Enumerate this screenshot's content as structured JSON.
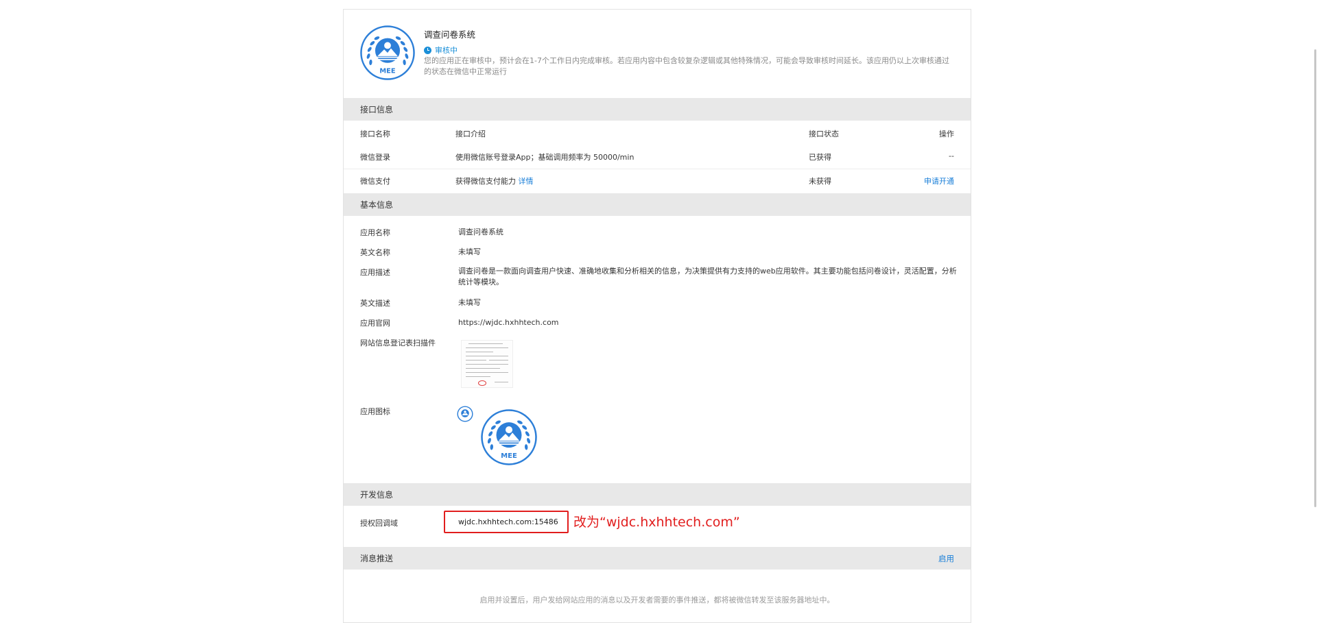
{
  "app": {
    "name": "调查问卷系统",
    "status": "审核中",
    "notice": "您的应用正在审核中，预计会在1-7个工作日内完成审核。若应用内容中包含较复杂逻辑或其他特殊情况，可能会导致审核时间延长。该应用仍以上次审核通过的状态在微信中正常运行",
    "logo_text": "MEE"
  },
  "interface": {
    "section_title": "接口信息",
    "columns": [
      "接口名称",
      "接口介绍",
      "接口状态",
      "操作"
    ],
    "rows": [
      {
        "name": "微信登录",
        "desc": "使用微信账号登录App；基础调用频率为 50000/min",
        "desc_link": "",
        "state": "已获得",
        "action": "--"
      },
      {
        "name": "微信支付",
        "desc": "获得微信支付能力",
        "desc_link": "详情",
        "state": "未获得",
        "action": "申请开通"
      }
    ]
  },
  "basic": {
    "section_title": "基本信息",
    "fields": {
      "app_name_label": "应用名称",
      "app_name": "调查问卷系统",
      "en_name_label": "英文名称",
      "en_name": "未填写",
      "desc_label": "应用描述",
      "desc": "调查问卷是一款面向调查用户快速、准确地收集和分析相关的信息，为决策提供有力支持的web应用软件。其主要功能包括问卷设计，灵活配置，分析统计等模块。",
      "en_desc_label": "英文描述",
      "en_desc": "未填写",
      "site_label": "应用官网",
      "site": "https://wjdc.hxhhtech.com",
      "scan_label": "网站信息登记表扫描件",
      "icon_label": "应用图标"
    }
  },
  "dev": {
    "section_title": "开发信息",
    "domain_label": "授权回调域",
    "domain_value": "wjdc.hxhhtech.com:15486",
    "annotation": "改为“wjdc.hxhhtech.com”"
  },
  "push": {
    "section_title": "消息推送",
    "enable_label": "启用",
    "note": "启用并设置后，用户发给网站应用的消息以及开发者需要的事件推送，都将被微信转发至该服务器地址中。"
  },
  "colors": {
    "accent": "#1a7fd8",
    "annotation": "#e11d1d",
    "section_bg": "#e8e8e8",
    "logo_blue": "#2d7fd8"
  }
}
